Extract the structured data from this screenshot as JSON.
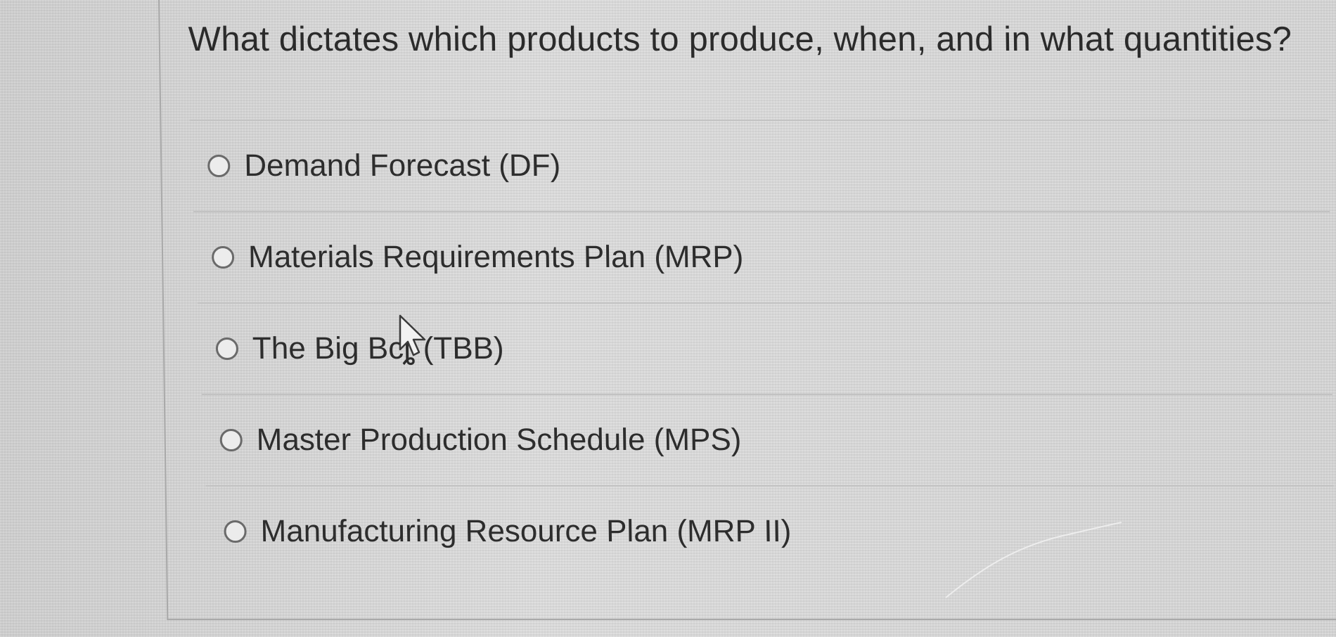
{
  "question": {
    "text": "What dictates which products to produce, when, and in what quantities?"
  },
  "options": [
    {
      "label": "Demand Forecast (DF)",
      "selected": false
    },
    {
      "label": "Materials Requirements Plan (MRP)",
      "selected": false
    },
    {
      "label": "The Big Bcȴ (TBB)",
      "selected": false
    },
    {
      "label": "Master Production Schedule (MPS)",
      "selected": false
    },
    {
      "label": "Manufacturing Resource Plan (MRP II)",
      "selected": false
    }
  ],
  "colors": {
    "background": "#d9d9d9",
    "text": "#2f2f2f",
    "divider": "#c2c2c2",
    "radio_border": "#6a6a6a"
  },
  "icons": {
    "cursor": "arrow-cursor-icon",
    "radio": "radio-empty-icon"
  }
}
